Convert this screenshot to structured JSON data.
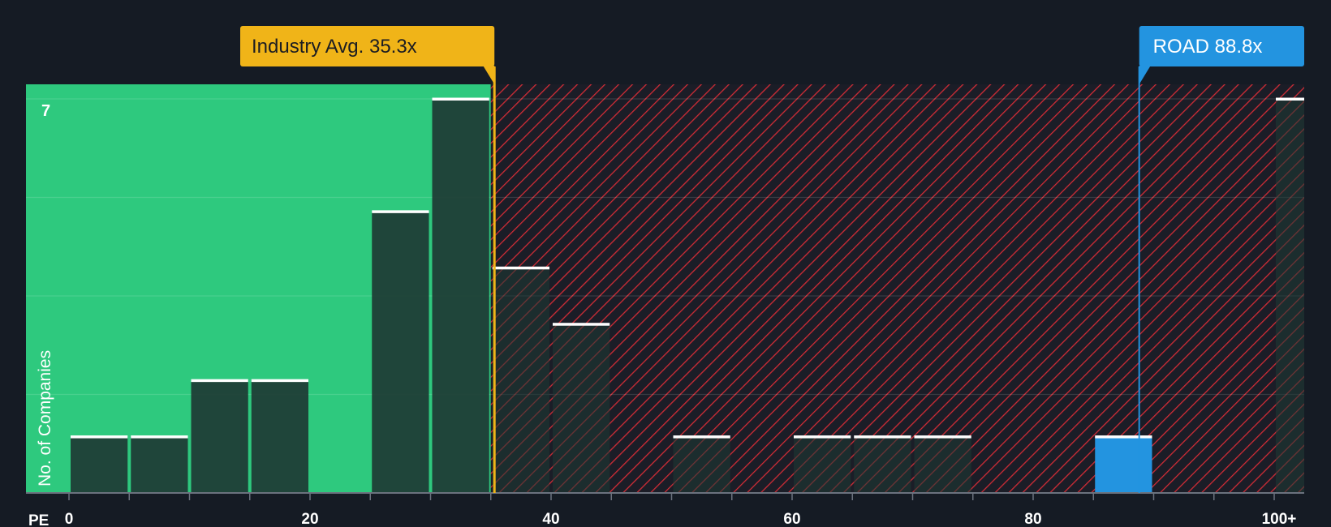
{
  "chart_data": {
    "type": "bar",
    "xlabel": "PE",
    "ylabel": "No. of Companies",
    "x_ticks": [
      "0",
      "20",
      "40",
      "60",
      "80",
      "100+"
    ],
    "y_tick_labels": [
      "7"
    ],
    "ylim": [
      0,
      7
    ],
    "grid": true,
    "bin_width": 5,
    "bins": [
      {
        "from": 0,
        "to": 5,
        "count": 1
      },
      {
        "from": 5,
        "to": 10,
        "count": 1
      },
      {
        "from": 10,
        "to": 15,
        "count": 2
      },
      {
        "from": 15,
        "to": 20,
        "count": 2
      },
      {
        "from": 20,
        "to": 25,
        "count": 0
      },
      {
        "from": 25,
        "to": 30,
        "count": 5
      },
      {
        "from": 30,
        "to": 35,
        "count": 7
      },
      {
        "from": 35,
        "to": 40,
        "count": 4
      },
      {
        "from": 40,
        "to": 45,
        "count": 3
      },
      {
        "from": 45,
        "to": 50,
        "count": 0
      },
      {
        "from": 50,
        "to": 55,
        "count": 1
      },
      {
        "from": 55,
        "to": 60,
        "count": 0
      },
      {
        "from": 60,
        "to": 65,
        "count": 1
      },
      {
        "from": 65,
        "to": 70,
        "count": 1
      },
      {
        "from": 70,
        "to": 75,
        "count": 1
      },
      {
        "from": 75,
        "to": 80,
        "count": 0
      },
      {
        "from": 80,
        "to": 85,
        "count": 0
      },
      {
        "from": 85,
        "to": 90,
        "count": 1,
        "highlight": true
      },
      {
        "from": 90,
        "to": 95,
        "count": 0
      },
      {
        "from": 95,
        "to": 100,
        "count": 0
      },
      {
        "from": 100,
        "to": 105,
        "count": 7
      }
    ],
    "industry_avg": {
      "label": "Industry Avg. 35.3x",
      "value": 35.3
    },
    "company": {
      "label": "ROAD 88.8x",
      "value": 88.8
    },
    "colors": {
      "background": "#151b24",
      "fair_zone": "#2ec97e",
      "expensive_hatch": "#e0303a",
      "bar_dark": "#1e3a34",
      "bar_highlight": "#2394e0",
      "industry_marker": "#f0b418",
      "company_marker": "#2394e0"
    }
  }
}
